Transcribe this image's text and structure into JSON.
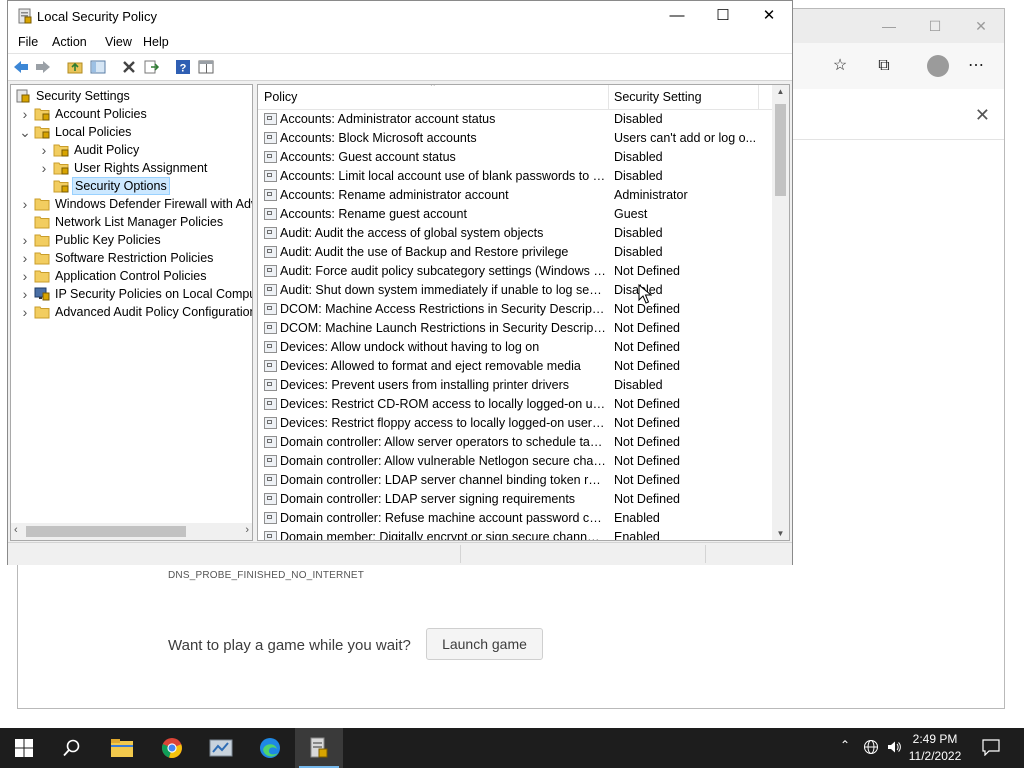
{
  "browser": {
    "error_code": "DNS_PROBE_FINISHED_NO_INTERNET",
    "game_prompt": "Want to play a game while you wait?",
    "launch_button": "Launch game"
  },
  "window": {
    "title": "Local Security Policy",
    "menu": [
      "File",
      "Action",
      "View",
      "Help"
    ]
  },
  "tree": [
    {
      "label": "Security Settings",
      "expander": "",
      "depth": 0,
      "icon": "shield-icon"
    },
    {
      "label": "Account Policies",
      "expander": ">",
      "depth": 1,
      "icon": "folder-lock-icon"
    },
    {
      "label": "Local Policies",
      "expander": "v",
      "depth": 1,
      "icon": "folder-lock-icon"
    },
    {
      "label": "Audit Policy",
      "expander": ">",
      "depth": 2,
      "icon": "folder-lock-icon"
    },
    {
      "label": "User Rights Assignment",
      "expander": ">",
      "depth": 2,
      "icon": "folder-lock-icon"
    },
    {
      "label": "Security Options",
      "expander": "",
      "depth": 2,
      "icon": "folder-lock-icon",
      "selected": true
    },
    {
      "label": "Windows Defender Firewall with Adva",
      "expander": ">",
      "depth": 1,
      "icon": "folder-icon"
    },
    {
      "label": "Network List Manager Policies",
      "expander": "",
      "depth": 1,
      "icon": "folder-icon"
    },
    {
      "label": "Public Key Policies",
      "expander": ">",
      "depth": 1,
      "icon": "folder-icon"
    },
    {
      "label": "Software Restriction Policies",
      "expander": ">",
      "depth": 1,
      "icon": "folder-icon"
    },
    {
      "label": "Application Control Policies",
      "expander": ">",
      "depth": 1,
      "icon": "folder-icon"
    },
    {
      "label": "IP Security Policies on Local Compute",
      "expander": ">",
      "depth": 1,
      "icon": "ipsec-icon"
    },
    {
      "label": "Advanced Audit Policy Configuration",
      "expander": ">",
      "depth": 1,
      "icon": "folder-icon"
    }
  ],
  "list": {
    "columns": [
      "Policy",
      "Security Setting"
    ],
    "rows": [
      [
        "Accounts: Administrator account status",
        "Disabled"
      ],
      [
        "Accounts: Block Microsoft accounts",
        "Users can't add or log o..."
      ],
      [
        "Accounts: Guest account status",
        "Disabled"
      ],
      [
        "Accounts: Limit local account use of blank passwords to co...",
        "Disabled"
      ],
      [
        "Accounts: Rename administrator account",
        "Administrator"
      ],
      [
        "Accounts: Rename guest account",
        "Guest"
      ],
      [
        "Audit: Audit the access of global system objects",
        "Disabled"
      ],
      [
        "Audit: Audit the use of Backup and Restore privilege",
        "Disabled"
      ],
      [
        "Audit: Force audit policy subcategory settings (Windows Vis...",
        "Not Defined"
      ],
      [
        "Audit: Shut down system immediately if unable to log secur...",
        "Disabled"
      ],
      [
        "DCOM: Machine Access Restrictions in Security Descriptor D...",
        "Not Defined"
      ],
      [
        "DCOM: Machine Launch Restrictions in Security Descriptor ...",
        "Not Defined"
      ],
      [
        "Devices: Allow undock without having to log on",
        "Not Defined"
      ],
      [
        "Devices: Allowed to format and eject removable media",
        "Not Defined"
      ],
      [
        "Devices: Prevent users from installing printer drivers",
        "Disabled"
      ],
      [
        "Devices: Restrict CD-ROM access to locally logged-on user ...",
        "Not Defined"
      ],
      [
        "Devices: Restrict floppy access to locally logged-on user only",
        "Not Defined"
      ],
      [
        "Domain controller: Allow server operators to schedule tasks",
        "Not Defined"
      ],
      [
        "Domain controller: Allow vulnerable Netlogon secure chann...",
        "Not Defined"
      ],
      [
        "Domain controller: LDAP server channel binding token requi...",
        "Not Defined"
      ],
      [
        "Domain controller: LDAP server signing requirements",
        "Not Defined"
      ],
      [
        "Domain controller: Refuse machine account password chan...",
        "Enabled"
      ],
      [
        "Domain member: Digitally encrypt or sign secure channel d...",
        "Enabled"
      ]
    ]
  },
  "taskbar": {
    "time": "2:49 PM",
    "date": "11/2/2022"
  },
  "colors": {
    "taskbar": "#1d1d1d",
    "selection": "#cce8ff",
    "folder": "#e9c45b"
  }
}
